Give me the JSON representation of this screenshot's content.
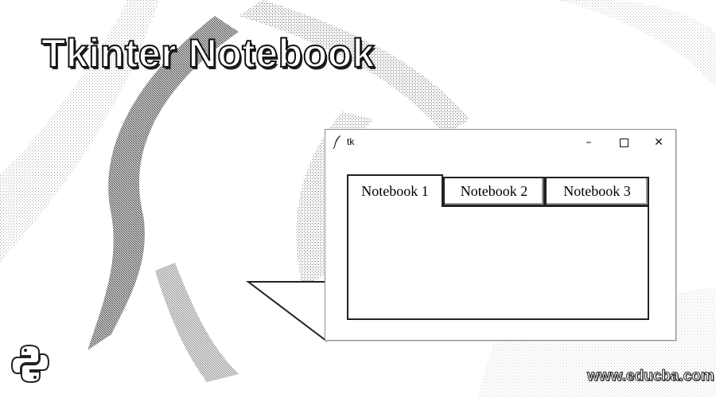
{
  "banner": {
    "title": "Tkinter Notebook"
  },
  "window": {
    "title": "tk",
    "controls": {
      "minimize": "–",
      "maximize": "",
      "close": "✕"
    }
  },
  "notebook": {
    "tabs": [
      {
        "label": "Notebook 1",
        "selected": true
      },
      {
        "label": "Notebook 2",
        "selected": false
      },
      {
        "label": "Notebook 3",
        "selected": false
      }
    ]
  },
  "watermark": {
    "text": "www.educba.com"
  },
  "icons": {
    "app": "feather-icon",
    "brand": "python-logo-icon"
  },
  "colors": {
    "background": "#ffffff",
    "outline": "#222222",
    "dither": "#7a7a7a"
  }
}
